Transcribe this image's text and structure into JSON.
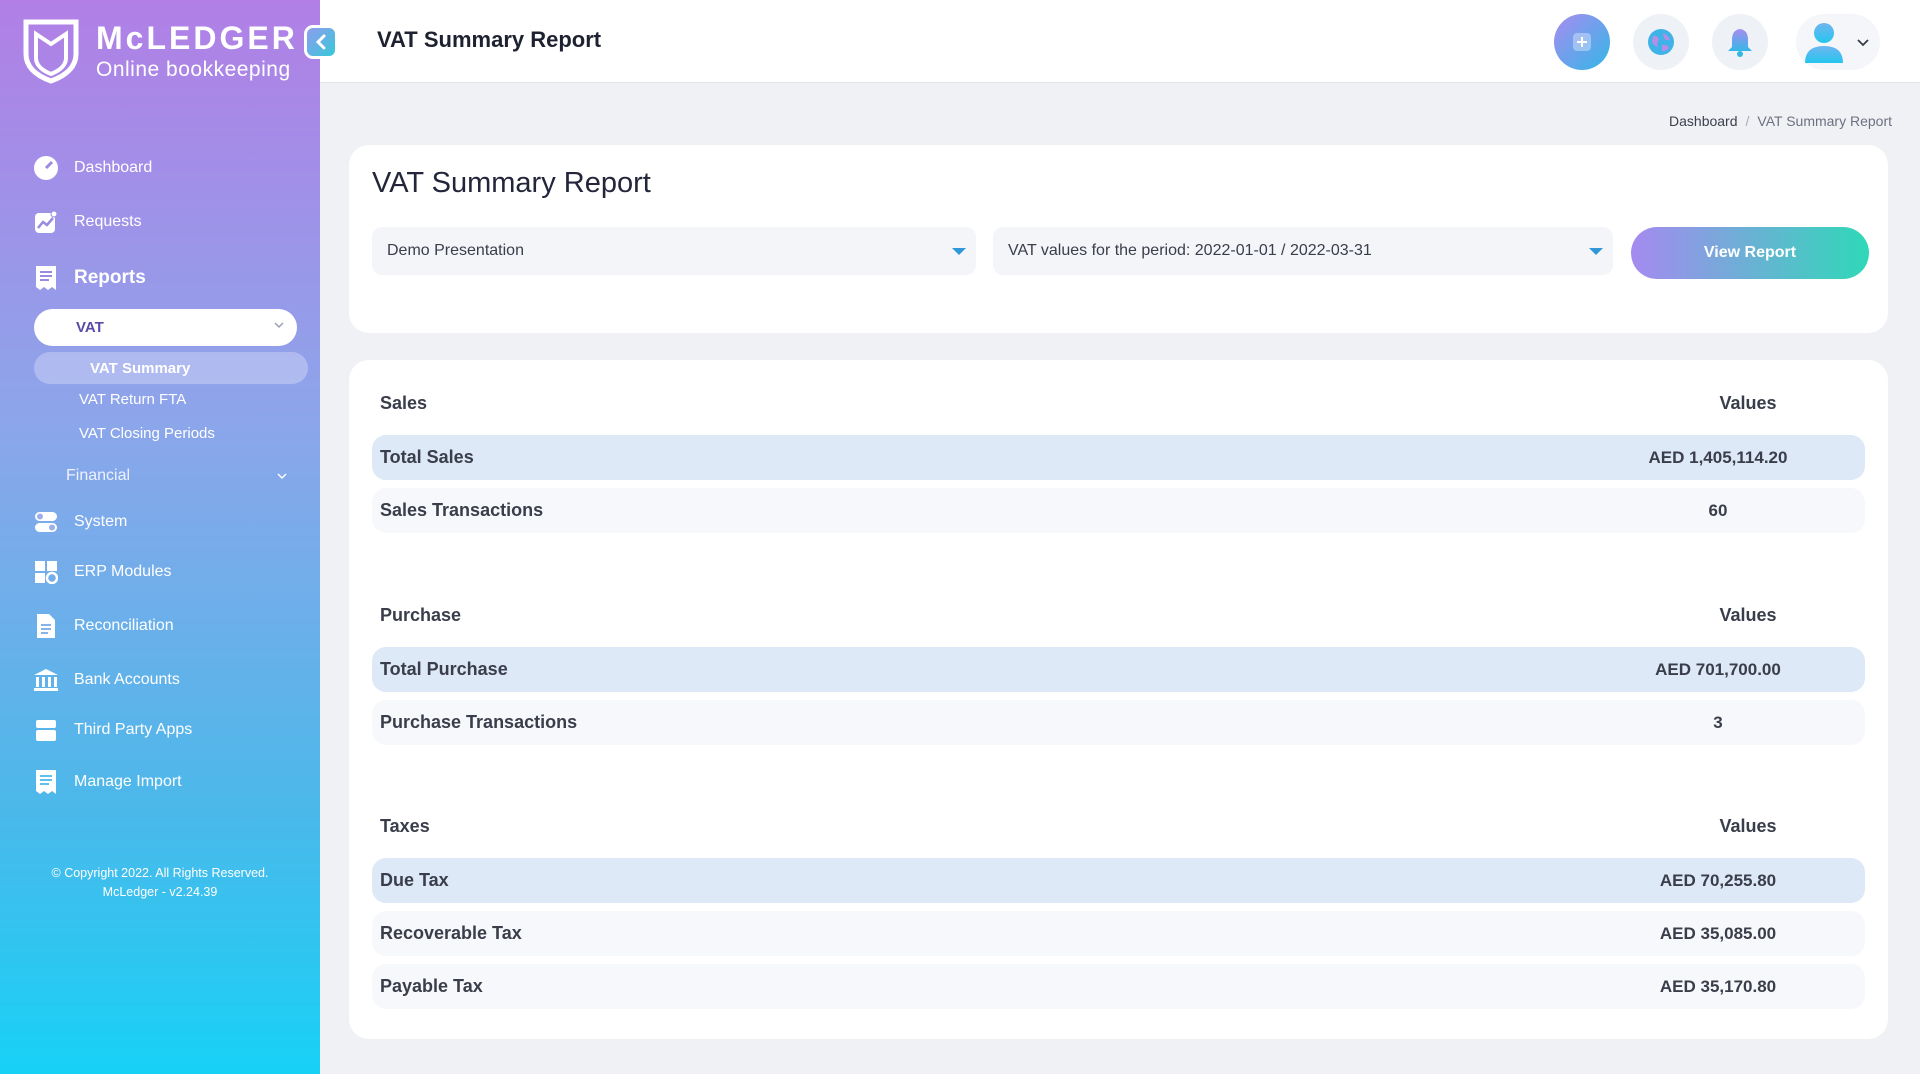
{
  "brand": {
    "name": "McLEDGER",
    "tagline": "Online bookkeeping"
  },
  "header": {
    "title": "VAT Summary Report"
  },
  "sidebar": {
    "items": {
      "dashboard": "Dashboard",
      "requests": "Requests",
      "reports": "Reports",
      "vat": "VAT",
      "vat_summary": "VAT Summary",
      "vat_return_fta": "VAT Return FTA",
      "vat_closing_periods": "VAT Closing Periods",
      "financial": "Financial",
      "system": "System",
      "erp_modules": "ERP Modules",
      "reconciliation": "Reconciliation",
      "bank_accounts": "Bank Accounts",
      "third_party_apps": "Third Party Apps",
      "manage_import": "Manage Import"
    },
    "copyright_line1": "© Copyright 2022. All Rights Reserved.",
    "copyright_line2": "McLedger - v2.24.39"
  },
  "breadcrumb": {
    "home": "Dashboard",
    "separator": "/",
    "current": "VAT Summary Report"
  },
  "filters": {
    "title": "VAT Summary Report",
    "company_select": "Demo Presentation",
    "period_select": "VAT values for the period: 2022-01-01 / 2022-03-31",
    "view_button": "View Report"
  },
  "report": {
    "sales": {
      "heading": "Sales",
      "values_heading": "Values",
      "rows": [
        {
          "label": "Total Sales",
          "value": "AED 1,405,114.20"
        },
        {
          "label": "Sales Transactions",
          "value": "60"
        }
      ]
    },
    "purchase": {
      "heading": "Purchase",
      "values_heading": "Values",
      "rows": [
        {
          "label": "Total Purchase",
          "value": "AED 701,700.00"
        },
        {
          "label": "Purchase Transactions",
          "value": "3"
        }
      ]
    },
    "taxes": {
      "heading": "Taxes",
      "values_heading": "Values",
      "rows": [
        {
          "label": "Due Tax",
          "value": "AED 70,255.80"
        },
        {
          "label": "Recoverable Tax",
          "value": "AED 35,085.00"
        },
        {
          "label": "Payable Tax",
          "value": "AED 35,170.80"
        }
      ]
    }
  },
  "colors": {
    "accent_purple": "#a58af0",
    "accent_teal": "#2fd8b8",
    "highlight_row": "#dde9f6"
  }
}
